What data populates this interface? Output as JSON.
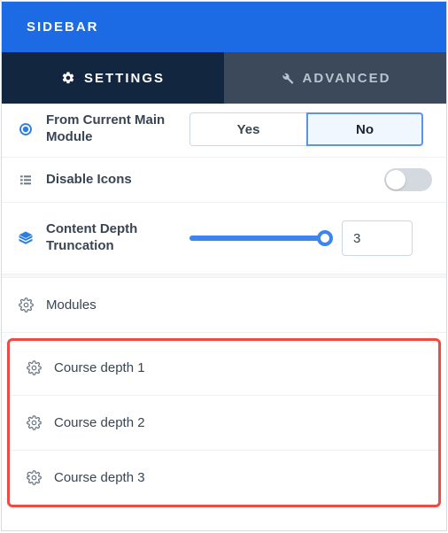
{
  "header": {
    "title": "SIDEBAR"
  },
  "tabs": {
    "settings": "SETTINGS",
    "advanced": "ADVANCED"
  },
  "options": {
    "from_current_main_module": {
      "label": "From Current Main Module",
      "yes": "Yes",
      "no": "No",
      "value": "No"
    },
    "disable_icons": {
      "label": "Disable Icons",
      "value": false
    },
    "content_depth_truncation": {
      "label": "Content Depth Truncation",
      "value": "3"
    }
  },
  "modules_label": "Modules",
  "course_depth_items": [
    {
      "label": "Course depth 1"
    },
    {
      "label": "Course depth 2"
    },
    {
      "label": "Course depth 3"
    }
  ]
}
